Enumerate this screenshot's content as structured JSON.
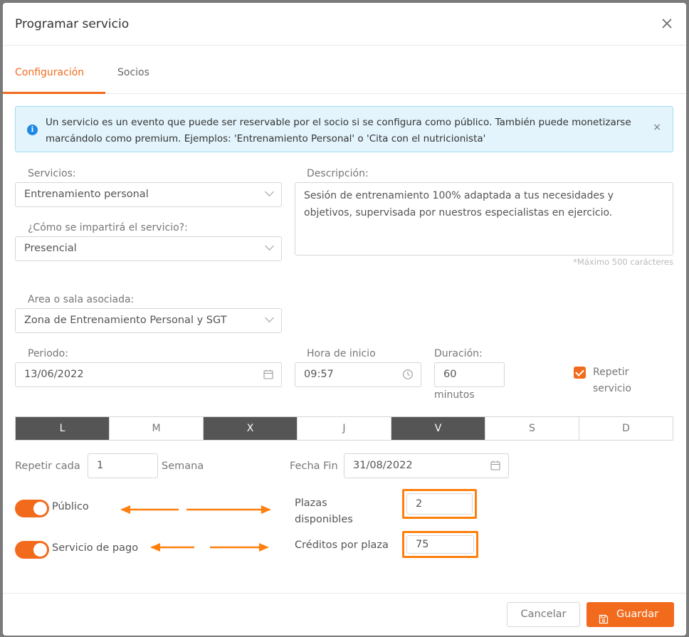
{
  "dialog": {
    "title": "Programar servicio"
  },
  "tabs": [
    {
      "label": "Configuración",
      "active": true
    },
    {
      "label": "Socios",
      "active": false
    }
  ],
  "info": {
    "text": "Un servicio es un evento que puede ser reservable por el socio si se configura como público. También puede monetizarse marcándolo como premium. Ejemplos: 'Entrenamiento Personal' o 'Cita con el nutricionista'",
    "close": "×"
  },
  "form": {
    "servicios": {
      "label": "Servicios:",
      "value": "Entrenamiento personal"
    },
    "imparte": {
      "label": "¿Cómo se impartirá el servicio?:",
      "value": "Presencial"
    },
    "descripcion": {
      "label": "Descripción:",
      "value": "Sesión de entrenamiento 100% adaptada a tus necesidades y objetivos, supervisada por nuestros especialistas en ejercicio.",
      "hint": "*Máximo 500 carácteres"
    },
    "area": {
      "label": "Area o sala asociada:",
      "value": "Zona de Entrenamiento Personal y SGT"
    },
    "periodo": {
      "label": "Periodo:",
      "value": "13/06/2022"
    },
    "hora": {
      "label": "Hora de inicio",
      "value": "09:57"
    },
    "duracion": {
      "label": "Duración:",
      "value": "60",
      "unit": "minutos"
    },
    "repetir": {
      "label_line1": "Repetir",
      "label_line2": "servicio",
      "checked": true
    },
    "days": [
      {
        "label": "L",
        "on": true
      },
      {
        "label": "M",
        "on": false
      },
      {
        "label": "X",
        "on": true
      },
      {
        "label": "J",
        "on": false
      },
      {
        "label": "V",
        "on": true
      },
      {
        "label": "S",
        "on": false
      },
      {
        "label": "D",
        "on": false
      }
    ],
    "repetir_cada": {
      "label": "Repetir cada",
      "value": "1",
      "unit": "Semana"
    },
    "fecha_fin": {
      "label": "Fecha Fin",
      "value": "31/08/2022"
    },
    "publico": {
      "label": "Público",
      "on": true
    },
    "pago": {
      "label": "Servicio de pago",
      "on": true
    },
    "plazas": {
      "label_line1": "Plazas",
      "label_line2": "disponibles",
      "value": "2"
    },
    "creditos": {
      "label": "Créditos por plaza",
      "value": "75"
    }
  },
  "footer": {
    "cancel": "Cancelar",
    "save": "Guardar"
  },
  "colors": {
    "accent": "#f26b1d",
    "highlight": "#ff7f0e",
    "day_active": "#555555",
    "info_bg": "#e3f4fc"
  },
  "icons": [
    "close-icon",
    "info-icon",
    "chevron-down-icon",
    "calendar-icon",
    "clock-icon",
    "save-icon",
    "arrow-icon"
  ]
}
